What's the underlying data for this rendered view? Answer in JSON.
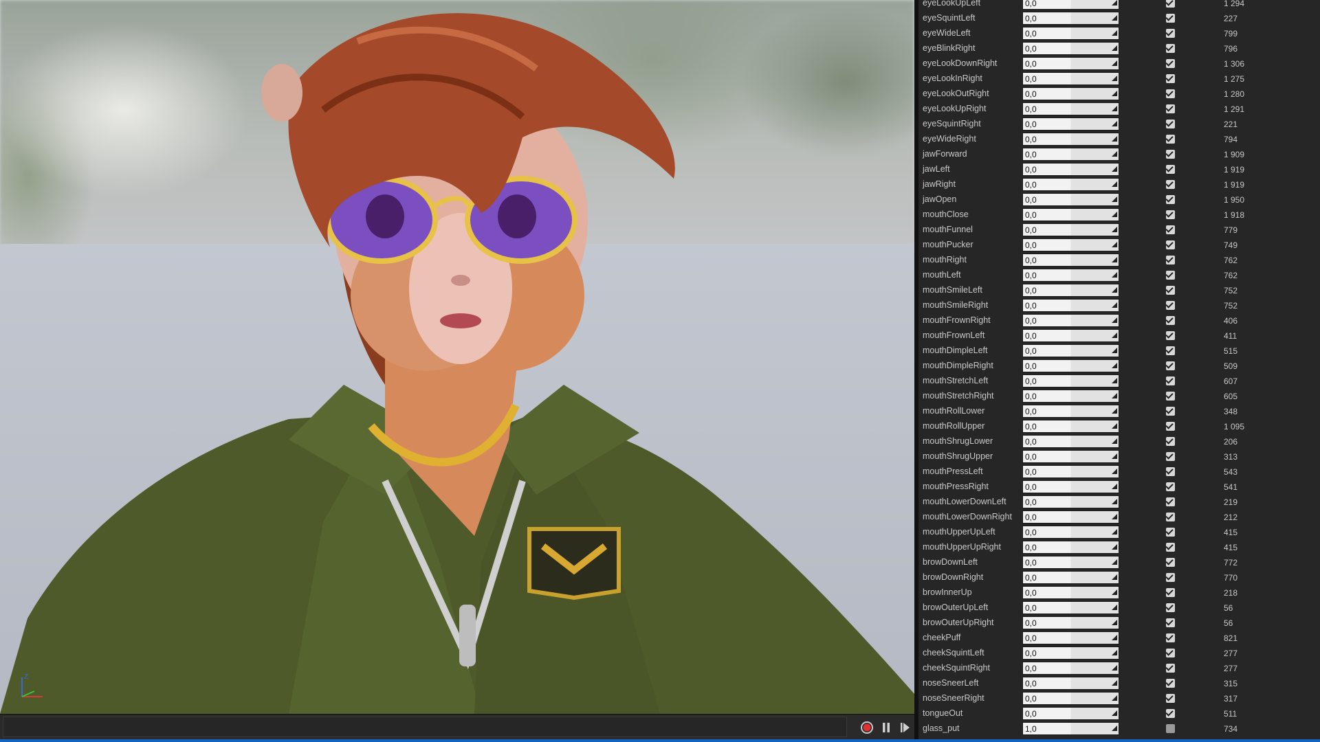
{
  "viewport": {
    "axis": {
      "z_label": "Z"
    }
  },
  "timeline": {
    "record_icon": "record-icon",
    "pause_icon": "pause-icon",
    "step_icon": "step-forward-icon"
  },
  "colors": {
    "panel_bg": "#262626",
    "accent_strip": "#1565c0"
  },
  "blendshapes": [
    {
      "name": "eyeLookUpLeft",
      "value": "0,0",
      "enabled": true,
      "count": "1 294"
    },
    {
      "name": "eyeSquintLeft",
      "value": "0,0",
      "enabled": true,
      "count": "227"
    },
    {
      "name": "eyeWideLeft",
      "value": "0,0",
      "enabled": true,
      "count": "799"
    },
    {
      "name": "eyeBlinkRight",
      "value": "0,0",
      "enabled": true,
      "count": "796"
    },
    {
      "name": "eyeLookDownRight",
      "value": "0,0",
      "enabled": true,
      "count": "1 306"
    },
    {
      "name": "eyeLookInRight",
      "value": "0,0",
      "enabled": true,
      "count": "1 275"
    },
    {
      "name": "eyeLookOutRight",
      "value": "0,0",
      "enabled": true,
      "count": "1 280"
    },
    {
      "name": "eyeLookUpRight",
      "value": "0,0",
      "enabled": true,
      "count": "1 291"
    },
    {
      "name": "eyeSquintRight",
      "value": "0,0",
      "enabled": true,
      "count": "221"
    },
    {
      "name": "eyeWideRight",
      "value": "0,0",
      "enabled": true,
      "count": "794"
    },
    {
      "name": "jawForward",
      "value": "0,0",
      "enabled": true,
      "count": "1 909"
    },
    {
      "name": "jawLeft",
      "value": "0,0",
      "enabled": true,
      "count": "1 919"
    },
    {
      "name": "jawRight",
      "value": "0,0",
      "enabled": true,
      "count": "1 919"
    },
    {
      "name": "jawOpen",
      "value": "0,0",
      "enabled": true,
      "count": "1 950"
    },
    {
      "name": "mouthClose",
      "value": "0,0",
      "enabled": true,
      "count": "1 918"
    },
    {
      "name": "mouthFunnel",
      "value": "0,0",
      "enabled": true,
      "count": "779"
    },
    {
      "name": "mouthPucker",
      "value": "0,0",
      "enabled": true,
      "count": "749"
    },
    {
      "name": "mouthRight",
      "value": "0,0",
      "enabled": true,
      "count": "762"
    },
    {
      "name": "mouthLeft",
      "value": "0,0",
      "enabled": true,
      "count": "762"
    },
    {
      "name": "mouthSmileLeft",
      "value": "0,0",
      "enabled": true,
      "count": "752"
    },
    {
      "name": "mouthSmileRight",
      "value": "0,0",
      "enabled": true,
      "count": "752"
    },
    {
      "name": "mouthFrownRight",
      "value": "0,0",
      "enabled": true,
      "count": "406"
    },
    {
      "name": "mouthFrownLeft",
      "value": "0,0",
      "enabled": true,
      "count": "411"
    },
    {
      "name": "mouthDimpleLeft",
      "value": "0,0",
      "enabled": true,
      "count": "515"
    },
    {
      "name": "mouthDimpleRight",
      "value": "0,0",
      "enabled": true,
      "count": "509"
    },
    {
      "name": "mouthStretchLeft",
      "value": "0,0",
      "enabled": true,
      "count": "607"
    },
    {
      "name": "mouthStretchRight",
      "value": "0,0",
      "enabled": true,
      "count": "605"
    },
    {
      "name": "mouthRollLower",
      "value": "0,0",
      "enabled": true,
      "count": "348"
    },
    {
      "name": "mouthRollUpper",
      "value": "0,0",
      "enabled": true,
      "count": "1 095"
    },
    {
      "name": "mouthShrugLower",
      "value": "0,0",
      "enabled": true,
      "count": "206"
    },
    {
      "name": "mouthShrugUpper",
      "value": "0,0",
      "enabled": true,
      "count": "313"
    },
    {
      "name": "mouthPressLeft",
      "value": "0,0",
      "enabled": true,
      "count": "543"
    },
    {
      "name": "mouthPressRight",
      "value": "0,0",
      "enabled": true,
      "count": "541"
    },
    {
      "name": "mouthLowerDownLeft",
      "value": "0,0",
      "enabled": true,
      "count": "219"
    },
    {
      "name": "mouthLowerDownRight",
      "value": "0,0",
      "enabled": true,
      "count": "212"
    },
    {
      "name": "mouthUpperUpLeft",
      "value": "0,0",
      "enabled": true,
      "count": "415"
    },
    {
      "name": "mouthUpperUpRight",
      "value": "0,0",
      "enabled": true,
      "count": "415"
    },
    {
      "name": "browDownLeft",
      "value": "0,0",
      "enabled": true,
      "count": "772"
    },
    {
      "name": "browDownRight",
      "value": "0,0",
      "enabled": true,
      "count": "770"
    },
    {
      "name": "browInnerUp",
      "value": "0,0",
      "enabled": true,
      "count": "218"
    },
    {
      "name": "browOuterUpLeft",
      "value": "0,0",
      "enabled": true,
      "count": "56"
    },
    {
      "name": "browOuterUpRight",
      "value": "0,0",
      "enabled": true,
      "count": "56"
    },
    {
      "name": "cheekPuff",
      "value": "0,0",
      "enabled": true,
      "count": "821"
    },
    {
      "name": "cheekSquintLeft",
      "value": "0,0",
      "enabled": true,
      "count": "277"
    },
    {
      "name": "cheekSquintRight",
      "value": "0,0",
      "enabled": true,
      "count": "277"
    },
    {
      "name": "noseSneerLeft",
      "value": "0,0",
      "enabled": true,
      "count": "315"
    },
    {
      "name": "noseSneerRight",
      "value": "0,0",
      "enabled": true,
      "count": "317"
    },
    {
      "name": "tongueOut",
      "value": "0,0",
      "enabled": true,
      "count": "511"
    },
    {
      "name": "glass_put",
      "value": "1,0",
      "enabled": false,
      "count": "734"
    }
  ]
}
